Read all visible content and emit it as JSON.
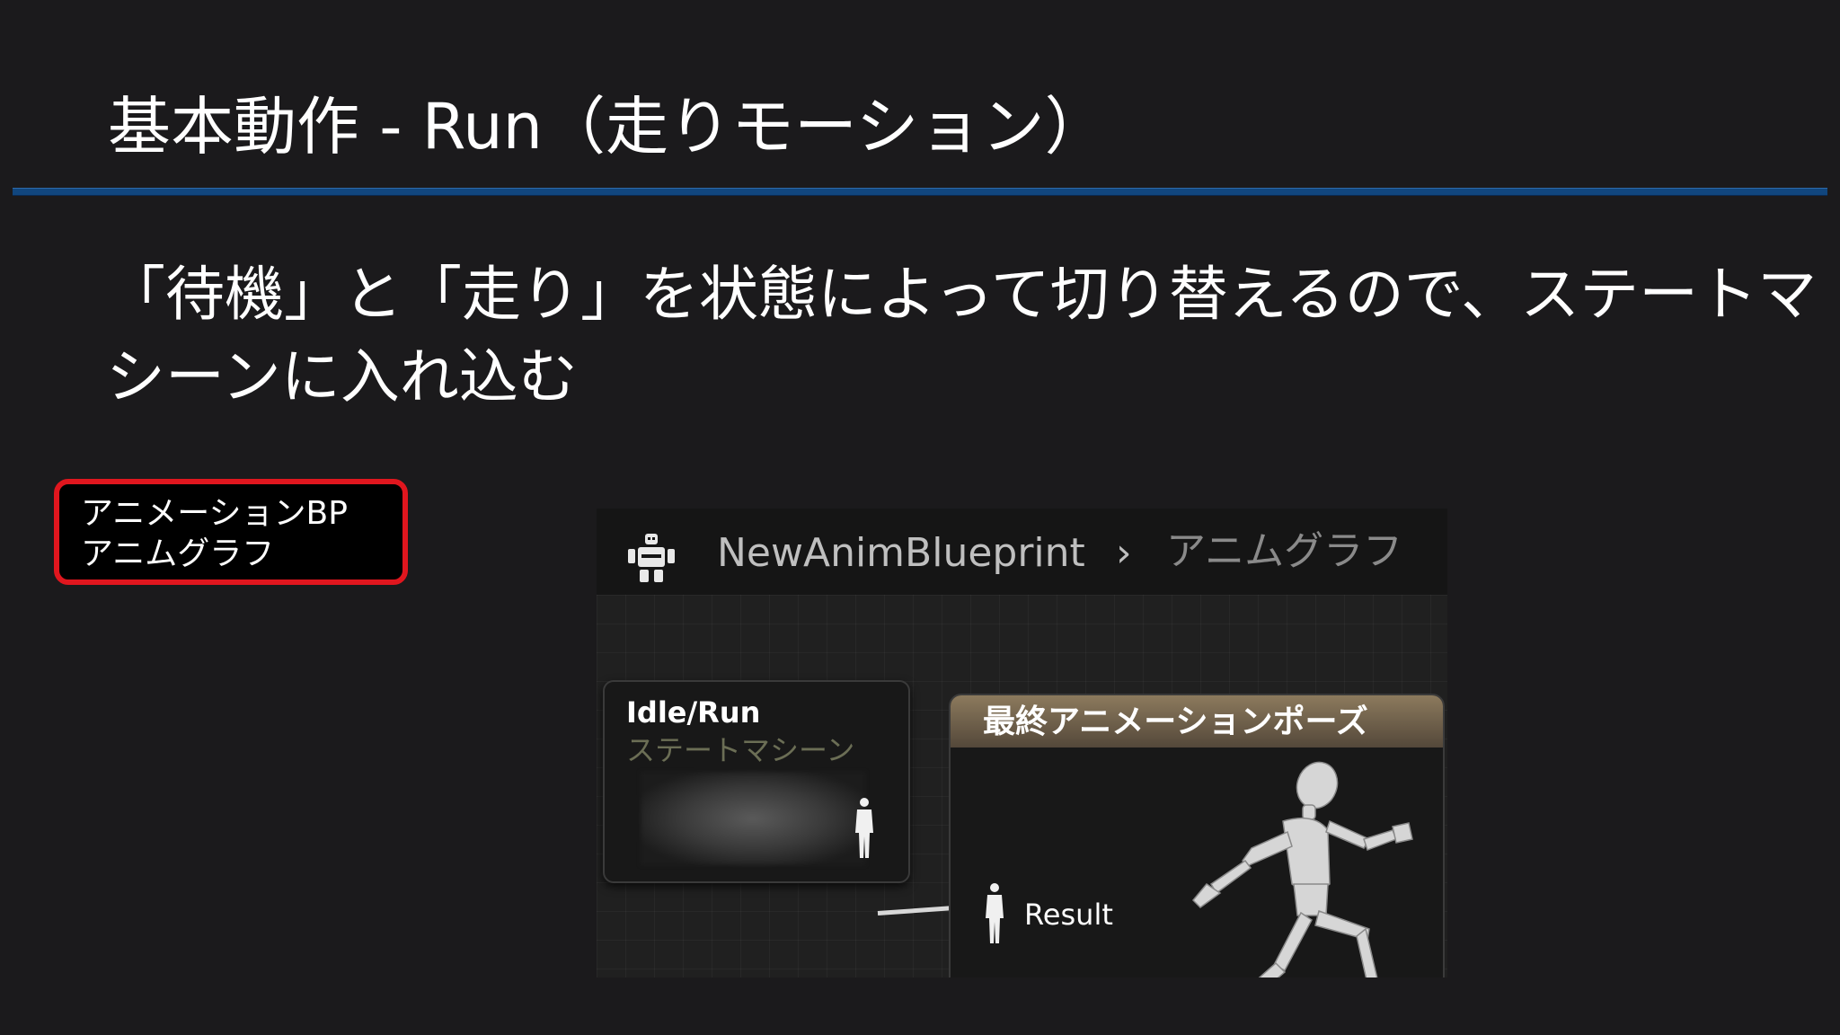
{
  "slide": {
    "title": "基本動作 - Run（走りモーション）",
    "body_lines": [
      "「待機」と「走り」を状態によって切り替えるので、ステートマ",
      "シーンに入れ込む"
    ]
  },
  "callout": {
    "lines": [
      "アニメーションBP",
      "アニムグラフ"
    ],
    "border_color": "#e0161e"
  },
  "editor": {
    "header": {
      "icon": "robot-icon",
      "breadcrumb_root": "NewAnimBlueprint",
      "separator": "›",
      "breadcrumb_current": "アニムグラフ"
    },
    "state_machine_node": {
      "title": "Idle/Run",
      "subtitle": "ステートマシーン",
      "output_pin_icon": "pose-pin-icon"
    },
    "output_pose_node": {
      "title": "最終アニメーションポーズ",
      "input_pin_label": "Result",
      "input_pin_icon": "pose-pin-icon",
      "preview_icon": "running-mannequin-icon"
    }
  },
  "colors": {
    "background": "#1b1a1c",
    "title_rule": "#11467e",
    "node_header": "#8c7a5d",
    "state_machine_subtitle": "#6b6e55"
  }
}
